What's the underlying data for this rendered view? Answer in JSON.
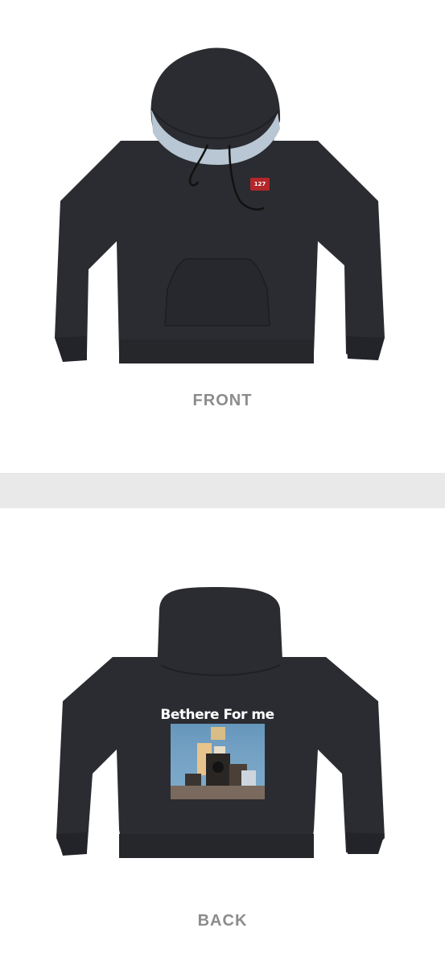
{
  "front": {
    "caption": "FRONT",
    "patch_text": "127"
  },
  "back": {
    "caption": "BACK",
    "graphic_text": "Bethere For me"
  },
  "colors": {
    "garment": "#2b2c31",
    "garment_shadow": "#1f2024",
    "hood_lining": "#b9c6d3",
    "patch": "#b3262a",
    "caption": "#8c8c8c",
    "graphic_bg": "#6f9fc2"
  }
}
